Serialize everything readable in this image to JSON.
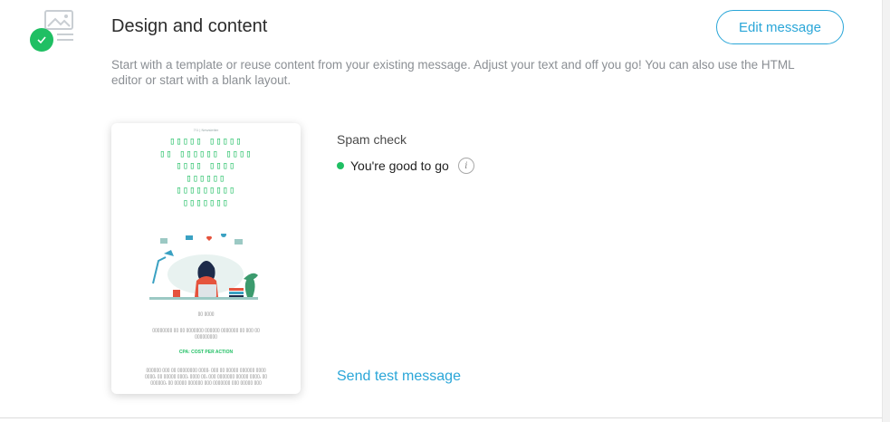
{
  "section": {
    "title": "Design and content",
    "edit_button": "Edit message",
    "description": "Start with a template or reuse content from your existing message. Adjust your text and off you go! You can also use the HTML editor or start with a blank layout.",
    "status_color": "#1fbf63",
    "accent_color": "#2aa6d8"
  },
  "preview": {
    "top_text": "7/1 | Newsletter",
    "headline": [
      "▯▯▯▯▯ ▯▯▯▯▯",
      "▯▯ ▯▯▯▯▯▯ ▯▯▯▯",
      "▯▯▯▯ ▯▯▯▯",
      "▯▯▯▯▯▯",
      "▯▯▯▯▯▯▯▯▯",
      "▯▯▯▯▯▯▯"
    ],
    "caption": "▯▯ ▯▯▯▯",
    "body": "▯▯▯▯▯▯▯▯ ▯▯ ▯▯ ▯▯▯▯▯▯▯ ▯▯▯▯▯▯ ▯▯▯▯▯▯▯ ▯▯ ▯▯▯ ▯▯ ▯▯▯▯▯▯▯▯▯",
    "cpa_label": "CPA: COST PER ACTION",
    "footer_text": "▯▯▯▯▯▯ ▯▯▯ ▯▯ ▯▯▯▯▯▯▯▯ ▯▯▯▯. ▯▯▯ ▯▯ ▯▯▯▯▯ ▯▯▯▯▯▯ ▯▯▯▯ ▯▯▯▯, ▯▯ ▯▯▯▯▯ ▯▯▯▯, ▯▯▯▯ ▯▯, ▯▯▯ ▯▯▯▯▯▯▯ ▯▯▯▯▯ ▯▯▯▯, ▯▯ ▯▯▯▯▯▯, ▯▯ ▯▯▯▯▯ ▯▯▯▯▯▯ ▯▯▯ ▯▯▯▯▯▯▯ ▯▯▯ ▯▯▯▯▯ ▯▯▯"
  },
  "spam_check": {
    "label": "Spam check",
    "status": "You're good to go",
    "info_icon": "info-icon"
  },
  "send_test": "Send test message"
}
